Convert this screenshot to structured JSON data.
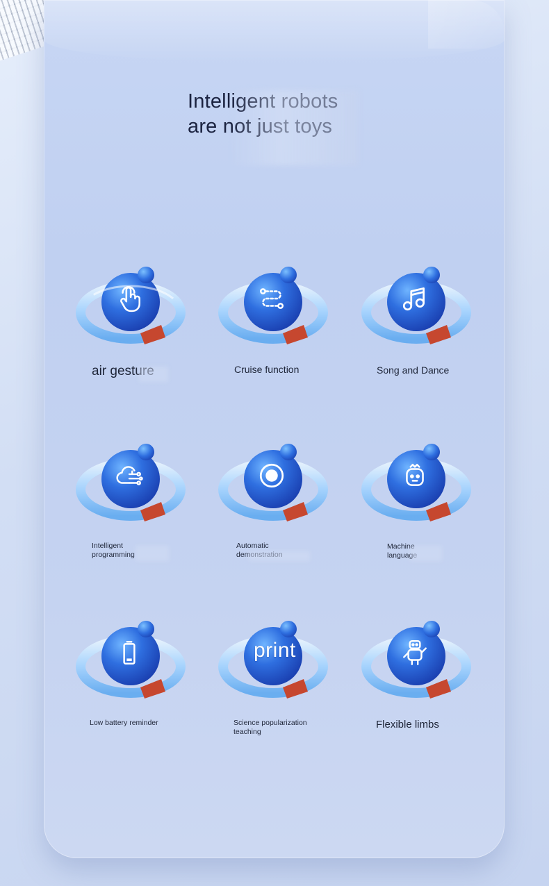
{
  "title": "Intelligent robots are not just toys",
  "features": [
    {
      "label": "air gesture",
      "icon": "hand-pointer-icon"
    },
    {
      "label": "Cruise function",
      "icon": "route-path-icon"
    },
    {
      "label": "Song and Dance",
      "icon": "music-note-icon"
    },
    {
      "label": "Intelligent programming",
      "icon": "cloud-circuit-icon"
    },
    {
      "label": "Automatic demonstration",
      "icon": "record-button-icon"
    },
    {
      "label": "Machine language",
      "icon": "robot-face-icon"
    },
    {
      "label": "Low battery reminder",
      "icon": "battery-icon"
    },
    {
      "label": "Science popularization teaching",
      "icon_text": "print"
    },
    {
      "label": "Flexible limbs",
      "icon": "robot-body-icon"
    }
  ],
  "colors": {
    "sphere": "#2f6fe0",
    "ring": "#9fd2ff",
    "accent": "#c6472f"
  }
}
